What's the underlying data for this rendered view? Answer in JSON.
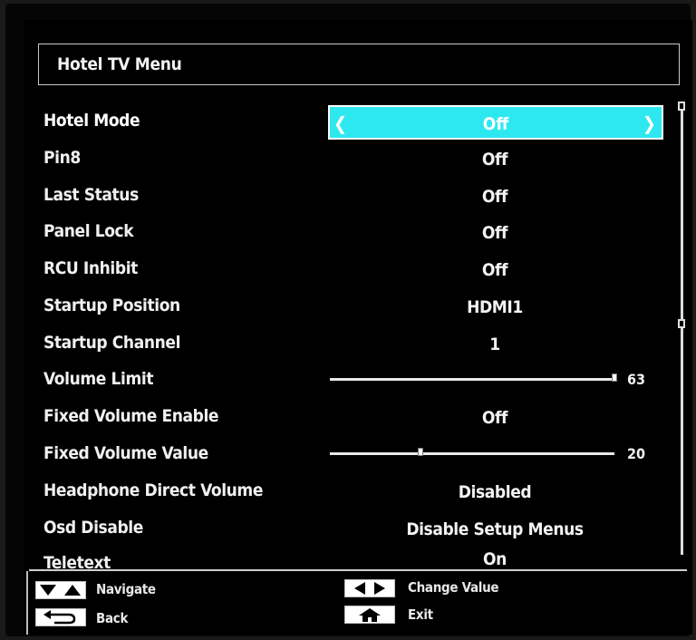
{
  "header": {
    "title": "Hotel TV Menu"
  },
  "rows": [
    {
      "label": "Hotel Mode",
      "value": "Off"
    },
    {
      "label": "Pin8",
      "value": "Off"
    },
    {
      "label": "Last Status",
      "value": "Off"
    },
    {
      "label": "Panel Lock",
      "value": "Off"
    },
    {
      "label": "RCU Inhibit",
      "value": "Off"
    },
    {
      "label": "Startup Position",
      "value": "HDMI1"
    },
    {
      "label": "Startup Channel",
      "value": "1"
    },
    {
      "label": "Volume Limit",
      "value": "63",
      "level": 63,
      "max": 63
    },
    {
      "label": "Fixed Volume Enable",
      "value": "Off"
    },
    {
      "label": "Fixed Volume Value",
      "value": "20",
      "level": 20,
      "max": 63
    },
    {
      "label": "Headphone Direct Volume",
      "value": "Disabled"
    },
    {
      "label": "Osd Disable",
      "value": "Disable Setup Menus"
    },
    {
      "label": "Teletext",
      "value": "On"
    }
  ],
  "footer": {
    "navigate": "Navigate",
    "back": "Back",
    "change_value": "Change Value",
    "exit": "Exit"
  },
  "colors": {
    "highlight": "#2ee8f0",
    "background": "#000000",
    "text": "#f2f2f2"
  }
}
